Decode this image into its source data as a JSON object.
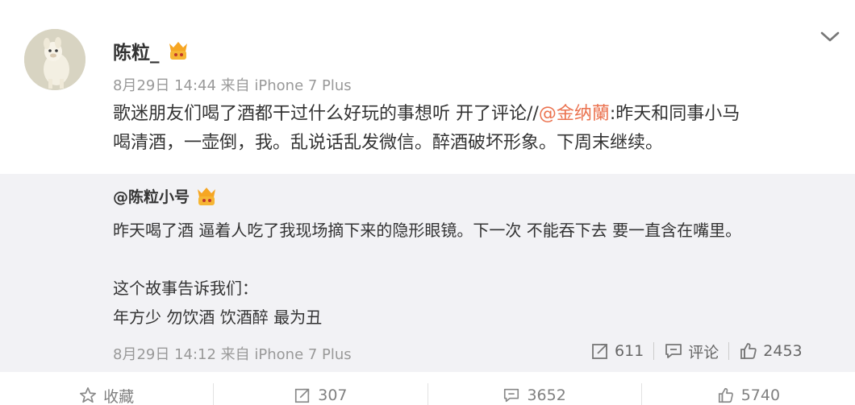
{
  "post": {
    "username": "陈粒_",
    "meta": "8月29日 14:44 来自 iPhone 7 Plus",
    "text_line1_a": "歌迷朋友们喝了酒都干过什么好玩的事想听 开了评论//",
    "mention": "@金纳蘭",
    "text_line1_b": ":昨天和同事小马",
    "text_line2": "喝清酒，一壶倒，我。乱说话乱发微信。醉酒破坏形象。下周末继续。"
  },
  "repost": {
    "author": "@陈粒小号",
    "lines": [
      "昨天喝了酒 逼着人吃了我现场摘下来的隐形眼镜。下一次 不能吞下去 要一直含在嘴里。",
      "这个故事告诉我们：",
      "年方少 勿饮酒 饮酒醉 最为丑"
    ],
    "meta": "8月29日 14:12 来自 iPhone 7 Plus",
    "forward_count": "611",
    "comment_label": "评论",
    "like_count": "2453"
  },
  "footer": {
    "favorite_label": "收藏",
    "forward_count": "307",
    "comment_count": "3652",
    "like_count": "5740"
  },
  "colors": {
    "accent": "#eb7350",
    "repost_bg": "#f2f2f5"
  }
}
